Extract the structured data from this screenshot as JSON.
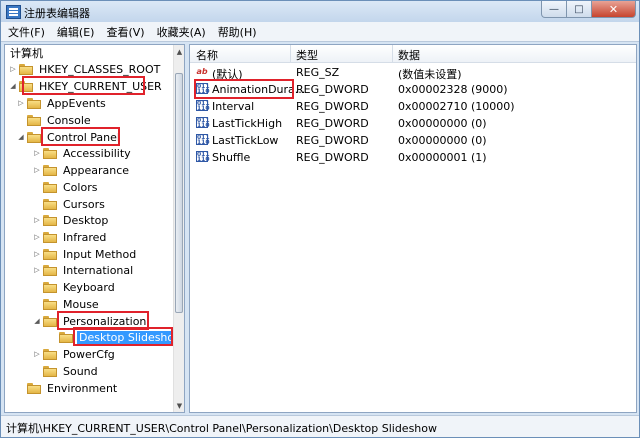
{
  "window": {
    "title": "注册表编辑器",
    "minimize_glyph": "—",
    "maximize_glyph": "□",
    "close_glyph": "✕"
  },
  "menu": [
    "文件(F)",
    "编辑(E)",
    "查看(V)",
    "收藏夹(A)",
    "帮助(H)"
  ],
  "tree": {
    "root": "计算机",
    "items": [
      {
        "label": "HKEY_CLASSES_ROOT"
      },
      {
        "label": "HKEY_CURRENT_USER"
      },
      {
        "label": "AppEvents"
      },
      {
        "label": "Console"
      },
      {
        "label": "Control Panel"
      },
      {
        "label": "Accessibility"
      },
      {
        "label": "Appearance"
      },
      {
        "label": "Colors"
      },
      {
        "label": "Cursors"
      },
      {
        "label": "Desktop"
      },
      {
        "label": "Infrared"
      },
      {
        "label": "Input Method"
      },
      {
        "label": "International"
      },
      {
        "label": "Keyboard"
      },
      {
        "label": "Mouse"
      },
      {
        "label": "Personalization"
      },
      {
        "label": "Desktop Slideshow"
      },
      {
        "label": "PowerCfg"
      },
      {
        "label": "Sound"
      },
      {
        "label": "Environment"
      }
    ]
  },
  "list": {
    "headers": {
      "name": "名称",
      "type": "类型",
      "data": "数据"
    },
    "rows": [
      {
        "name": "(默认)",
        "type": "REG_SZ",
        "data": "(数值未设置)",
        "icon": "string-value-icon"
      },
      {
        "name": "AnimationDura...",
        "type": "REG_DWORD",
        "data": "0x00002328 (9000)",
        "icon": "binary-value-icon"
      },
      {
        "name": "Interval",
        "type": "REG_DWORD",
        "data": "0x00002710 (10000)",
        "icon": "binary-value-icon"
      },
      {
        "name": "LastTickHigh",
        "type": "REG_DWORD",
        "data": "0x00000000 (0)",
        "icon": "binary-value-icon"
      },
      {
        "name": "LastTickLow",
        "type": "REG_DWORD",
        "data": "0x00000000 (0)",
        "icon": "binary-value-icon"
      },
      {
        "name": "Shuffle",
        "type": "REG_DWORD",
        "data": "0x00000001 (1)",
        "icon": "binary-value-icon"
      }
    ]
  },
  "status": {
    "path": "计算机\\HKEY_CURRENT_USER\\Control Panel\\Personalization\\Desktop Slideshow"
  },
  "colors": {
    "highlight_box": "#e0222b",
    "selection": "#3399ff"
  }
}
